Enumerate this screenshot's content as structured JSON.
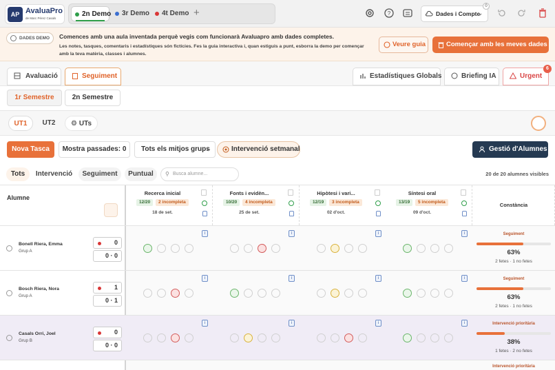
{
  "app": {
    "logo_main": "AvaluaPro",
    "logo_sub": "de Marc Pérez Casals",
    "logo_mark": "AP"
  },
  "demo_tabs": [
    {
      "label": "2n Demo",
      "dot": "#2f9e4a",
      "active": true
    },
    {
      "label": "3r Demo",
      "dot": "#3c6fd0",
      "active": false
    },
    {
      "label": "4t Demo",
      "dot": "#d93636",
      "active": false
    }
  ],
  "topbar": {
    "account_label": "Dades i Compte",
    "account_badge": "0"
  },
  "banner": {
    "badge": "DADES DEMO",
    "title": "Comences amb una aula inventada perquè vegis com funcionarà Avaluapro amb dades completes.",
    "text": "Les notes, tasques, comentaris i estadístiques són fictícies. Fes la guia interactiva i, quan estiguis a punt, esborra la demo per començar amb la teva matèria, classes i alumnes.",
    "guide_button": "Veure guia",
    "start_button": "Començar amb les meves dades"
  },
  "modes": {
    "avaluacio": "Avaluació",
    "seguiment": "Seguiment",
    "stats": "Estadístiques Globals",
    "briefing": "Briefing IA",
    "urgent": "Urgent",
    "urgent_count": "6"
  },
  "semesters": [
    "1r Semestre",
    "2n Semestre"
  ],
  "units": {
    "ut1": "UT1",
    "ut2": "UT2",
    "uts": "UTs"
  },
  "actions": {
    "new_task": "Nova Tasca",
    "show_passed": "Mostra passades: 0",
    "groups": "Tots els mitjos grups",
    "weekly": "Intervenció setmanal",
    "manage": "Gestió d'Alumnes"
  },
  "filters": {
    "all": "Tots",
    "intervention": "Intervenció",
    "followup": "Seguiment",
    "punctual": "Puntual",
    "search_placeholder": "Busca alumne...",
    "visible_count": "20 de 20 alumnes visibles"
  },
  "table": {
    "student_header": "Alumne",
    "consistency_header": "Constància",
    "tasks": [
      {
        "name": "Recerca inicial",
        "score": "12/20",
        "incomplete": "2 incompleta",
        "date": "18 de set."
      },
      {
        "name": "Fonts i evidèn...",
        "score": "10/20",
        "incomplete": "4 incompleta",
        "date": "25 de set."
      },
      {
        "name": "Hipòtesi i vari...",
        "score": "12/19",
        "incomplete": "3 incompleta",
        "date": "02 d'oct."
      },
      {
        "name": "Síntesi oral",
        "score": "13/19",
        "incomplete": "5 incompleta",
        "date": "09 d'oct."
      }
    ],
    "students": [
      {
        "name": "Bonell Riera, Emma",
        "group": "Grup A",
        "alerts": "0",
        "notes": "0",
        "extra": "0",
        "badge": "Seguiment",
        "percent": "63%",
        "pct": 63,
        "status": "2 fetes · 1 no fetes",
        "selected": false
      },
      {
        "name": "Bosch Riera, Nora",
        "group": "Grup A",
        "alerts": "1",
        "notes": "0",
        "extra": "1",
        "badge": "Seguiment",
        "percent": "63%",
        "pct": 63,
        "status": "2 fetes · 1 no fetes",
        "selected": false
      },
      {
        "name": "Casals Orri, Joel",
        "group": "Grup B",
        "alerts": "0",
        "notes": "0",
        "extra": "0",
        "badge": "Intervenció prioritària",
        "percent": "38%",
        "pct": 38,
        "status": "1 fetes · 2 no fetes",
        "selected": true
      }
    ],
    "partial_badge": "Intervenció prioritària"
  }
}
